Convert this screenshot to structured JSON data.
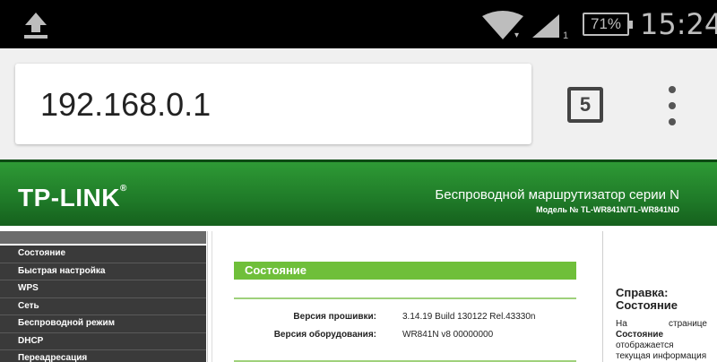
{
  "status_bar": {
    "battery": "71%",
    "time": "15:24",
    "sim_label": "1",
    "icons": [
      "upload-icon",
      "wifi-icon",
      "cell-signal-icon",
      "battery-icon"
    ]
  },
  "browser": {
    "url": "192.168.0.1",
    "tab_count": "5",
    "icons": [
      "tabs-switcher-icon",
      "overflow-menu-icon"
    ]
  },
  "router": {
    "brand": "TP-LINK",
    "brand_mark": "®",
    "header_title": "Беспроводной маршрутизатор серии N",
    "header_model": "Модель № TL-WR841N/TL-WR841ND",
    "nav": [
      "Состояние",
      "Быстрая настройка",
      "WPS",
      "Сеть",
      "Беспроводной режим",
      "DHCP",
      "Переадресация"
    ],
    "section_title": "Состояние",
    "rows": [
      {
        "label": "Версия прошивки:",
        "value": "3.14.19 Build 130122 Rel.43330n"
      },
      {
        "label": "Версия оборудования:",
        "value": "WR841N v8 00000000"
      }
    ],
    "help": {
      "title": "Справка: Состояние",
      "text_word_1": "На",
      "text_word_2": "странице",
      "text_bold": "Состояние",
      "text_line_3": "отображается",
      "text_line_4": "текущая информация"
    },
    "colors": {
      "banner": "#1f7a28",
      "section_bar": "#6fbf3a",
      "nav_bg": "#3a3a3a"
    }
  }
}
